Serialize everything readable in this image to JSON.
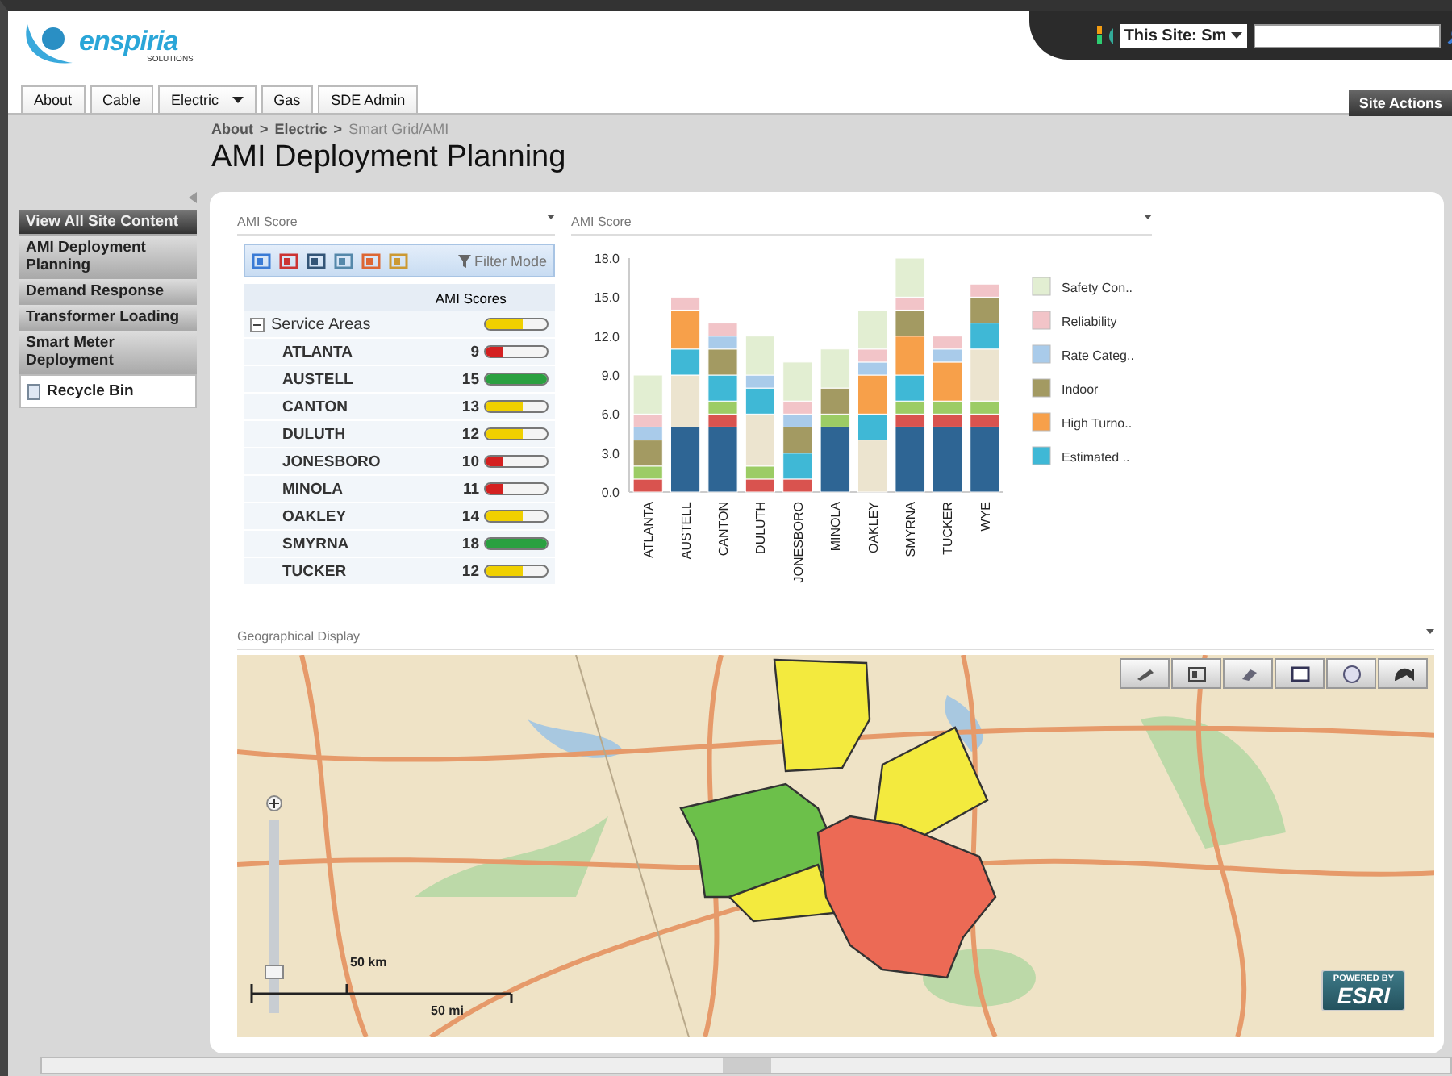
{
  "header": {
    "logo_text": "enspiria",
    "logo_subtext": "SOLUTIONS",
    "search_scope": "This Site: Sm",
    "site_actions": "Site Actions"
  },
  "nav_tabs": [
    {
      "label": "About",
      "dropdown": false
    },
    {
      "label": "Cable",
      "dropdown": false
    },
    {
      "label": "Electric",
      "dropdown": true
    },
    {
      "label": "Gas",
      "dropdown": false
    },
    {
      "label": "SDE Admin",
      "dropdown": false
    }
  ],
  "breadcrumb": {
    "items": [
      "About",
      "Electric",
      "Smart Grid/AMI"
    ],
    "separator": ">"
  },
  "page_title": "AMI Deployment Planning",
  "sidebar": {
    "items": [
      {
        "label": "View All Site Content",
        "kind": "header"
      },
      {
        "label": "AMI Deployment Planning",
        "kind": "link"
      },
      {
        "label": "Demand Response",
        "kind": "link"
      },
      {
        "label": "Transformer Loading",
        "kind": "link"
      },
      {
        "label": "Smart Meter Deployment",
        "kind": "link"
      },
      {
        "label": "Recycle Bin",
        "kind": "bin"
      }
    ]
  },
  "score_table": {
    "title": "AMI Score",
    "filter_label": "Filter Mode",
    "column": "AMI Scores",
    "group": {
      "label": "Service Areas",
      "expanded": true,
      "level": 0.6,
      "color": "#f0d000"
    },
    "rows": [
      {
        "name": "ATLANTA",
        "score": "9",
        "level": 0.3,
        "color": "#d42020"
      },
      {
        "name": "AUSTELL",
        "score": "15",
        "level": 1,
        "color": "#2aa040"
      },
      {
        "name": "CANTON",
        "score": "13",
        "level": 0.6,
        "color": "#f0d000"
      },
      {
        "name": "DULUTH",
        "score": "12",
        "level": 0.6,
        "color": "#f0d000"
      },
      {
        "name": "JONESBORO",
        "score": "10",
        "level": 0.3,
        "color": "#d42020"
      },
      {
        "name": "MINOLA",
        "score": "11",
        "level": 0.3,
        "color": "#d42020"
      },
      {
        "name": "OAKLEY",
        "score": "14",
        "level": 0.6,
        "color": "#f0d000"
      },
      {
        "name": "SMYRNA",
        "score": "18",
        "level": 1,
        "color": "#2aa040"
      },
      {
        "name": "TUCKER",
        "score": "12",
        "level": 0.6,
        "color": "#f0d000"
      }
    ]
  },
  "chart_panel": {
    "title": "AMI Score",
    "chart_data": {
      "type": "bar",
      "stacked": true,
      "orientation": "vertical",
      "categories": [
        "ATLANTA",
        "AUSTELL",
        "CANTON",
        "DULUTH",
        "JONESBORO",
        "MINOLA",
        "OAKLEY",
        "SMYRNA",
        "TUCKER",
        "WYE"
      ],
      "ylim": [
        0,
        18
      ],
      "legend": true,
      "yticks": [
        {
          "value": 0,
          "label": "0.0"
        },
        {
          "value": 3,
          "label": "3.0"
        },
        {
          "value": 6,
          "label": "6.0"
        },
        {
          "value": 9,
          "label": "9.0"
        },
        {
          "value": 12,
          "label": "12.0"
        },
        {
          "value": 15,
          "label": "15.0"
        },
        {
          "value": 18,
          "label": "18.0"
        }
      ],
      "series": [
        {
          "color": "#2e6594",
          "values": [
            0,
            5,
            5,
            0,
            0,
            5,
            0,
            5,
            5,
            5
          ]
        },
        {
          "color": "#d9534f",
          "values": [
            1,
            0,
            1,
            1,
            1,
            0,
            0,
            1,
            1,
            1
          ]
        },
        {
          "color": "#9ccc65",
          "values": [
            1,
            0,
            1,
            1,
            0,
            1,
            0,
            1,
            1,
            1
          ]
        },
        {
          "color": "#ece4cf",
          "values": [
            0,
            4,
            0,
            4,
            0,
            0,
            4,
            0,
            0,
            4
          ]
        },
        {
          "name": "Estimated ..",
          "color": "#3fb8d6",
          "values": [
            0,
            2,
            2,
            2,
            2,
            0,
            2,
            2,
            0,
            2
          ]
        },
        {
          "name": "High Turno..",
          "color": "#f7a04a",
          "values": [
            0,
            3,
            0,
            0,
            0,
            0,
            3,
            3,
            3,
            0
          ]
        },
        {
          "name": "Indoor",
          "color": "#a39a62",
          "values": [
            2,
            0,
            2,
            0,
            2,
            2,
            0,
            2,
            0,
            2
          ]
        },
        {
          "name": "Rate Categ..",
          "color": "#a9cbea",
          "values": [
            1,
            0,
            1,
            1,
            1,
            0,
            1,
            0,
            1,
            0
          ]
        },
        {
          "name": "Reliability",
          "color": "#f2c4c8",
          "values": [
            1,
            1,
            1,
            0,
            1,
            0,
            1,
            1,
            1,
            1
          ]
        },
        {
          "name": "Safety Con..",
          "color": "#e2eed2",
          "values": [
            3,
            0,
            0,
            3,
            3,
            3,
            3,
            3,
            0,
            0
          ]
        }
      ]
    }
  },
  "map_panel": {
    "title": "Geographical Display",
    "zoom": {
      "level": 0.2
    },
    "scale": [
      "50 km",
      "50 mi"
    ],
    "badge": [
      "POWERED BY",
      "ESRI"
    ]
  }
}
